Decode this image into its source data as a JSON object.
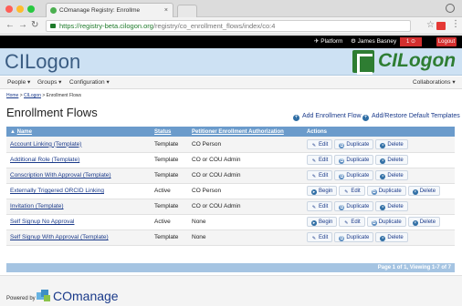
{
  "browser": {
    "tab_title": "COmanage Registry: Enrollme",
    "tab_close": "×",
    "url_host": "https://registry-beta.cilogon.org",
    "url_path": "/registry/co_enrollment_flows/index/co:4"
  },
  "topnav": {
    "platform": "Platform",
    "user": "James Basney",
    "notifications": "1",
    "logout": "Logout"
  },
  "site": {
    "title": "CILogon",
    "logo_text": "CILogon"
  },
  "mainmenu": {
    "people": "People ▾",
    "groups": "Groups ▾",
    "configuration": "Configuration ▾",
    "collaborations": "Collaborations ▾"
  },
  "breadcrumb": {
    "home": "Home",
    "co": "CILogon",
    "current": "Enrollment Flows"
  },
  "page": {
    "title": "Enrollment Flows",
    "add_flow": "Add Enrollment Flow",
    "add_restore": "Add/Restore Default Templates"
  },
  "table": {
    "headers": {
      "name": "Name",
      "status": "Status",
      "auth": "Petitioner Enrollment Authorization",
      "actions": "Actions"
    },
    "buttons": {
      "begin": "Begin",
      "edit": "Edit",
      "duplicate": "Duplicate",
      "delete": "Delete"
    },
    "rows": [
      {
        "name": "Account Linking (Template)",
        "status": "Template",
        "auth": "CO Person"
      },
      {
        "name": "Additional Role (Template)",
        "status": "Template",
        "auth": "CO or COU Admin"
      },
      {
        "name": "Conscription With Approval (Template)",
        "status": "Template",
        "auth": "CO or COU Admin"
      },
      {
        "name": "Externally Triggered ORCID Linking",
        "status": "Active",
        "auth": "CO Person"
      },
      {
        "name": "Invitation (Template)",
        "status": "Template",
        "auth": "CO or COU Admin"
      },
      {
        "name": "Self Signup No Approval",
        "status": "Active",
        "auth": "None"
      },
      {
        "name": "Self Signup With Approval (Template)",
        "status": "Template",
        "auth": "None"
      }
    ]
  },
  "pager": "Page 1 of 1, Viewing 1-7 of 7",
  "footer": {
    "powered_by": "Powered by",
    "product": "COmanage"
  }
}
